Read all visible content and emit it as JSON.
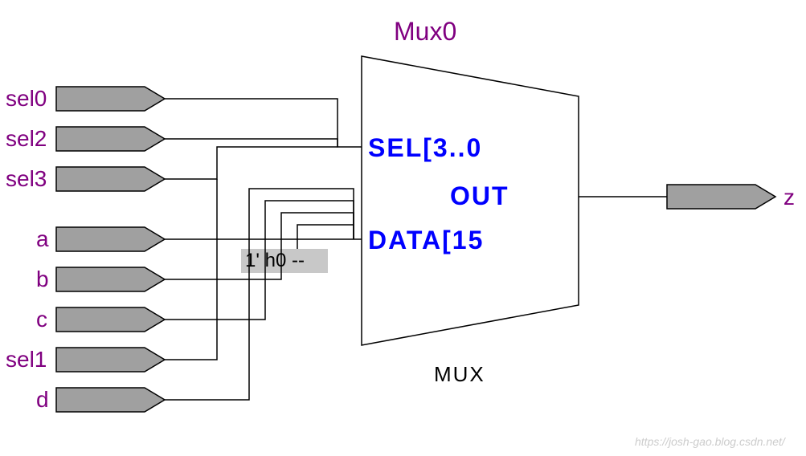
{
  "title": "Mux0",
  "mux_type": "MUX",
  "ports_in": [
    "sel0",
    "sel2",
    "sel3",
    "a",
    "b",
    "c",
    "sel1",
    "d"
  ],
  "port_out": "z",
  "mux_ports": {
    "sel": "SEL[3..0",
    "out": "OUT",
    "data": "DATA[15"
  },
  "constant": "1' h0 --",
  "watermark": "https://josh-gao.blog.csdn.net/"
}
